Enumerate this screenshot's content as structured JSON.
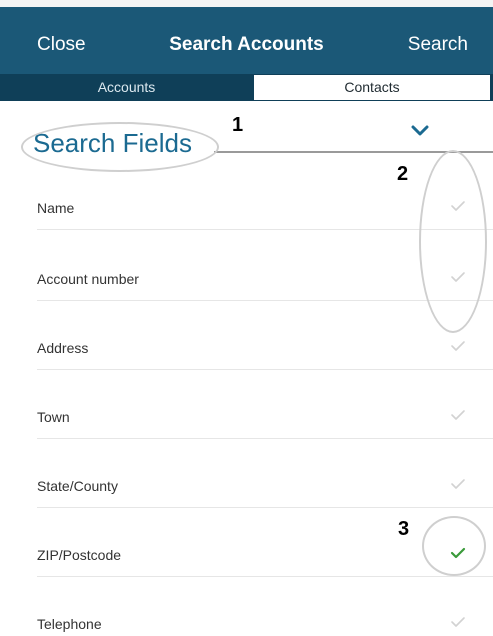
{
  "navbar": {
    "close_label": "Close",
    "title": "Search Accounts",
    "search_label": "Search"
  },
  "tabs": [
    {
      "label": "Accounts",
      "selected": false
    },
    {
      "label": "Contacts",
      "selected": true
    }
  ],
  "section": {
    "title": "Search Fields",
    "toggle_icon": "chevron-down-icon"
  },
  "fields": [
    {
      "label": "Name",
      "checked": false
    },
    {
      "label": "Account number",
      "checked": false
    },
    {
      "label": "Address",
      "checked": false
    },
    {
      "label": "Town",
      "checked": false
    },
    {
      "label": "State/County",
      "checked": false
    },
    {
      "label": "ZIP/Postcode",
      "checked": true
    },
    {
      "label": "Telephone",
      "checked": false
    }
  ],
  "annotations": [
    "1",
    "2",
    "3"
  ],
  "colors": {
    "navbar": "#1b5877",
    "segment_bar": "#0f3f58",
    "section_title": "#1b6a91",
    "check_on": "#3a9a3a",
    "check_off": "#d2d2d2"
  }
}
